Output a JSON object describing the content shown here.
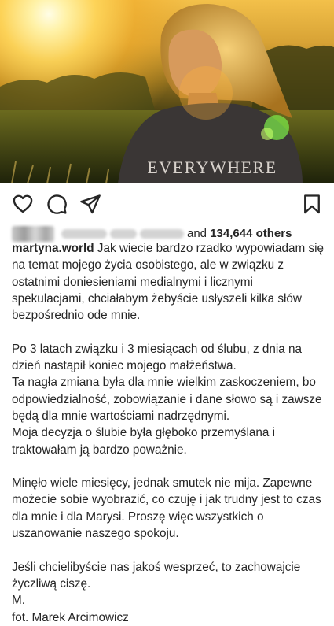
{
  "post": {
    "image_alt": "Woman in sunlit field wearing EVERYWHERE sweatshirt",
    "shirt_text": "EVERYWHERE"
  },
  "actions": {
    "like_icon": "heart-icon",
    "comment_icon": "comment-icon",
    "share_icon": "send-icon",
    "save_icon": "bookmark-icon"
  },
  "likes": {
    "prefix": "and ",
    "count": "134,644 others"
  },
  "caption": {
    "username": "martyna.world",
    "text": " Jak wiecie bardzo rzadko wypowiadam się na temat mojego życia osobistego, ale w związku z ostatnimi doniesieniami medialnymi i licznymi spekulacjami, chciałabym żebyście usłyszeli kilka słów bezpośrednio ode mnie.\n\nPo 3 latach związku i 3 miesiącach od ślubu, z dnia na dzień nastąpił koniec mojego małżeństwa.\nTa nagła zmiana była dla mnie wielkim zaskoczeniem, bo odpowiedzialność, zobowiązanie i dane słowo są i zawsze będą dla mnie wartościami nadrzędnymi.\nMoja decyzja o ślubie była głęboko przemyślana i traktowałam ją bardzo poważnie.\n\nMinęło wiele miesięcy, jednak smutek nie mija. Zapewne możecie sobie wyobrazić, co czuję i jak trudny jest to czas dla mnie i dla Marysi. Proszę więc wszystkich o uszanowanie naszego spokoju.\n\nJeśli chcielibyście nas jakoś wesprzeć, to zachowajcie życzliwą ciszę.\nM.\nfot. Marek Arcimowicz"
  }
}
